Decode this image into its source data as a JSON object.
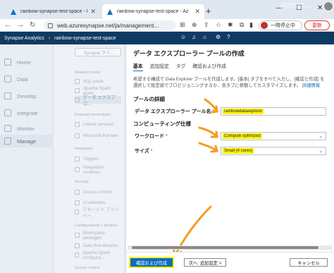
{
  "browser": {
    "tabs": [
      {
        "title": "rainbow-synapse-test-space - Mi",
        "active": false
      },
      {
        "title": "rainbow-synapse-test-space - Az",
        "active": true
      }
    ],
    "new_tab": "+",
    "url": "web.azuresynapse.net/ja/management...",
    "paused_label": "一時停止中",
    "update_label": "更新",
    "window_controls": [
      "—",
      "☐",
      "✕"
    ]
  },
  "synapse": {
    "product": "Synapse Analytics",
    "workspace": "rainbow-synapse-test-space",
    "directory_label": "既定のディレクトリ",
    "directory_user": "@outlook.com"
  },
  "leftnav": [
    {
      "label": "Home",
      "icon": "home-icon"
    },
    {
      "label": "Data",
      "icon": "data-icon"
    },
    {
      "label": "Develop",
      "icon": "develop-icon"
    },
    {
      "label": "Integrate",
      "icon": "integrate-icon"
    },
    {
      "label": "Monitor",
      "icon": "monitor-icon"
    },
    {
      "label": "Manage",
      "icon": "manage-icon",
      "selected": true
    }
  ],
  "subnav": {
    "search_placeholder": "Synapse ライ...",
    "sections": [
      {
        "title": "Analytics pools",
        "items": [
          "SQL pools",
          "Apache Spark pools",
          "データ エクスプロ..."
        ]
      },
      {
        "title": "External connections",
        "items": [
          "Linked services",
          "Microsoft Purview"
        ]
      },
      {
        "title": "Integration",
        "items": [
          "Triggers",
          "Integration runtimes"
        ]
      },
      {
        "title": "Security",
        "items": [
          "Access control",
          "Credentials",
          "マネージド プライベー..."
        ]
      },
      {
        "title": "Configurations + libraries",
        "items": [
          "Workspace packages",
          "Data flow libraries",
          "Apache Spark configura..."
        ]
      },
      {
        "title": "Source control",
        "items": []
      }
    ]
  },
  "panel": {
    "title": "データ エクスプローラー プールの作成",
    "tabs": [
      "基本",
      "追加設定",
      "タグ",
      "確認および作成"
    ],
    "description": "希望する構成で Data Explorer プールを作成します。[基本] タブをすべて入力し、[確認と作成] を選択して既定値でプロビジョニングするか、各タブに移動してカスタマイズします。",
    "description_link": "詳細情報",
    "section_pool": "プールの詳細",
    "section_compute": "コンピューティング仕様",
    "fields": {
      "pool_name_label": "データ エクスプローラー プール名",
      "pool_name_value": "rainbowdataexplorer",
      "workload_label": "ワークロード",
      "workload_value": "Compute optimized",
      "size_label": "サイズ",
      "size_value": "Small (4 cores)"
    },
    "required_mark": "*",
    "buttons": {
      "create": "確認および作成",
      "next": "次へ: 追加設定 >",
      "cancel": "キャンセル"
    }
  },
  "colors": {
    "brand_header": "#0f3a63",
    "primary": "#0f6cbd",
    "highlight": "#fff200",
    "annotation_arrow": "#f59b1c"
  }
}
